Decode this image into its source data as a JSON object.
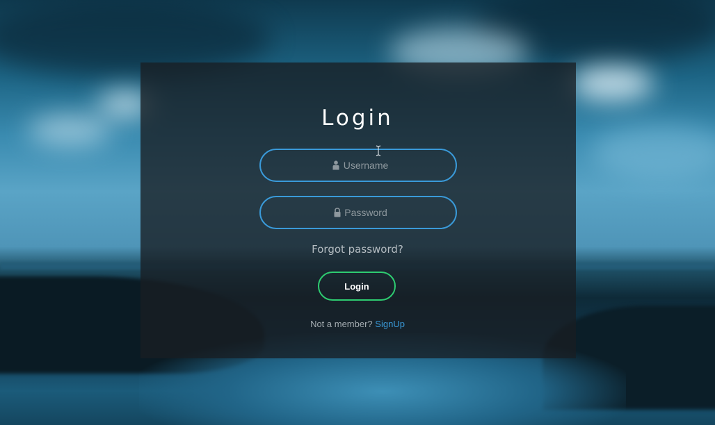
{
  "login_form": {
    "title": "Login",
    "username_placeholder": "Username",
    "password_placeholder": "Password",
    "forgot_password": "Forgot password?",
    "login_button": "Login",
    "signup_prompt": "Not a member?",
    "signup_link": "SignUp",
    "icons": {
      "username": "user-icon",
      "password": "lock-icon"
    }
  },
  "colors": {
    "input_border": "#3a9ad9",
    "button_border": "#2ecc71",
    "link": "#3a9ad9",
    "panel_background": "rgba(24, 30, 34, 0.78)"
  }
}
